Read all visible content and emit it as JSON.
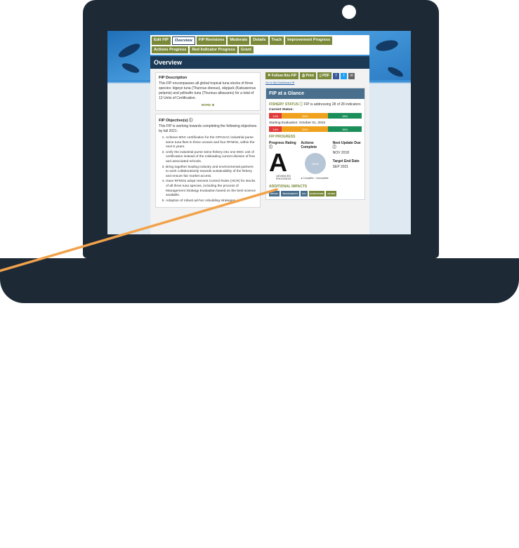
{
  "tabs": [
    {
      "label": "Edit FIP",
      "active": false
    },
    {
      "label": "Overview",
      "active": true
    },
    {
      "label": "FIP Revisions",
      "active": false
    },
    {
      "label": "Moderate",
      "active": false
    },
    {
      "label": "Details",
      "active": false
    },
    {
      "label": "Track",
      "active": false
    },
    {
      "label": "Improvement Progress",
      "active": false
    },
    {
      "label": "Actions Progress",
      "active": false
    },
    {
      "label": "Red Indicator Progress",
      "active": false
    },
    {
      "label": "Grant",
      "active": false
    }
  ],
  "overview_title": "Overview",
  "description": {
    "heading": "FIP Description",
    "text": "This FIP encompasses all global tropical tuna stocks of three species: bigeye tuna (Thunnus obesus), skipjack (Katsuwonus pelamis) and yellowfin tuna (Thunnus albacares) for a total of 13 Units of Certification.",
    "more": "MORE ⊕"
  },
  "objectives": {
    "heading": "FIP Objective(s) ⓘ",
    "intro": "This FIP is working towards completing the following objectives by fall 2021:",
    "items": [
      "Achieve MSC certification for the OPAGAC industrial purse seine tuna fleet in three oceans and four RFMOs, within the next 5 years.",
      "Unify the industrial purse seine fishery into one MSC unit of certification instead of the misleading current division of free and associated schools.",
      "Bring together leading industry and environmental partners to work collaboratively towards sustainability of the fishery and ensure fair market access.",
      "Have RFMOs adopt Harvest Control Rules (HCR) for stocks of all three tuna species, including the process of Management Strategy Evaluation based on the best science available.",
      "Adoption of robust ad-hoc rebuilding strategies, in"
    ]
  },
  "actions": {
    "follow": "Follow this FIP",
    "print": "Print",
    "pdf": "PDF",
    "dashboard": "Go to My Dashboard ⊕"
  },
  "glance": {
    "title": "FIP at a Glance",
    "fishery_status_label": "FISHERY STATUS ⓘ",
    "fishery_status_text": "FIP is addressing 28 of 28 indicators",
    "current_status_label": "Current Status:",
    "current_status": [
      {
        "label": "14%",
        "pct": 14,
        "color": "#e03a3a"
      },
      {
        "label": "50%",
        "pct": 50,
        "color": "#f0a21f"
      },
      {
        "label": "36%",
        "pct": 36,
        "color": "#1b8f5a"
      }
    ],
    "starting_label": "Starting Evaluation: October 01, 2016",
    "starting_status": [
      {
        "label": "14%",
        "pct": 14,
        "color": "#e03a3a"
      },
      {
        "label": "50%",
        "pct": 50,
        "color": "#f0a21f"
      },
      {
        "label": "36%",
        "pct": 36,
        "color": "#1b8f5a"
      }
    ],
    "progress_label": "FIP PROGRESS",
    "progress_rating_label": "Progress Rating ⓘ",
    "progress_rating": "A",
    "progress_rating_desc": "ADVANCED PROGRESS",
    "actions_complete_label": "Actions Complete",
    "actions_complete_value": "100%",
    "legend_complete": "● Complete",
    "legend_incomplete": "○ Incomplete",
    "next_update_label": "Next Update Due ⓘ",
    "next_update_value": "NOV 2018",
    "target_end_label": "Target End Date",
    "target_end_value": "SEP 2021",
    "impacts_label": "ADDITIONAL IMPACTS",
    "impacts": [
      "SOCIAL",
      "TRACEABILITY",
      "IUU",
      "ECOSYSTEM",
      "OTHER"
    ]
  },
  "colors": {
    "tab_green": "#7a8a3a",
    "navy": "#1c3a55",
    "glance_blue": "#4a6f8c",
    "pointer_orange": "#f2a24a"
  }
}
